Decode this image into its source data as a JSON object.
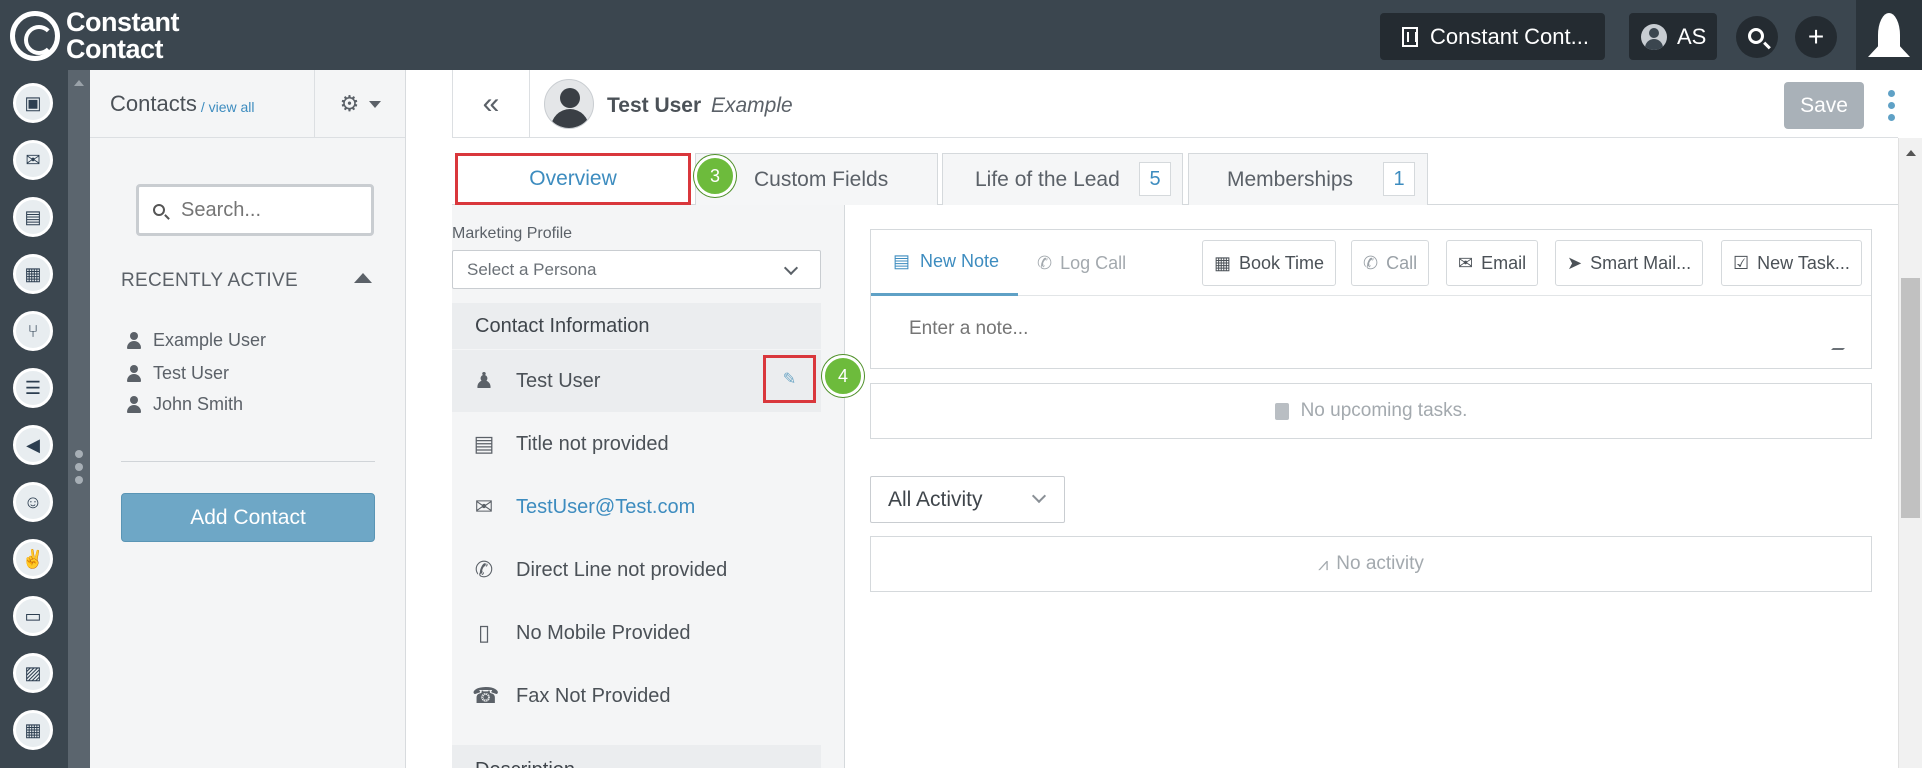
{
  "topbar": {
    "brand_line1": "Constant",
    "brand_line2": "Contact",
    "account_label": "Constant Cont...",
    "user_initials": "AS"
  },
  "rail": {
    "icons": [
      "contacts-icon",
      "inbox-icon",
      "clipboard-icon",
      "map-icon",
      "pipeline-icon",
      "list-icon",
      "megaphone-icon",
      "chat-icon",
      "thumbs-up-icon",
      "tv-icon",
      "image-icon",
      "calendar-icon"
    ]
  },
  "sidebar": {
    "title": "Contacts",
    "view_all": "/ view all",
    "search_placeholder": "Search...",
    "recent_heading": "RECENTLY ACTIVE",
    "recent": [
      "Example User",
      "Test User",
      "John Smith"
    ],
    "add_contact": "Add Contact"
  },
  "header": {
    "name": "Test User",
    "company": "Example",
    "save": "Save"
  },
  "tabs": {
    "overview": "Overview",
    "custom_fields": "Custom Fields",
    "life_of_lead": "Life of the Lead",
    "life_of_lead_count": "5",
    "memberships": "Memberships",
    "memberships_count": "1"
  },
  "steps": {
    "step3": "3",
    "step4": "4"
  },
  "details": {
    "marketing_profile_label": "Marketing Profile",
    "persona_value": "Select a Persona",
    "contact_info_heading": "Contact Information",
    "name": "Test User",
    "title": "Title not provided",
    "email": "TestUser@Test.com",
    "direct_line": "Direct Line not provided",
    "mobile": "No Mobile Provided",
    "fax": "Fax Not Provided",
    "description_heading": "Description"
  },
  "activity": {
    "new_note": "New Note",
    "log_call": "Log Call",
    "book_time": "Book Time",
    "call": "Call",
    "email": "Email",
    "smart_mail": "Smart Mail...",
    "new_task": "New Task...",
    "note_placeholder": "Enter a note...",
    "no_tasks": "No upcoming tasks.",
    "filter": "All Activity",
    "no_activity": "No activity"
  }
}
